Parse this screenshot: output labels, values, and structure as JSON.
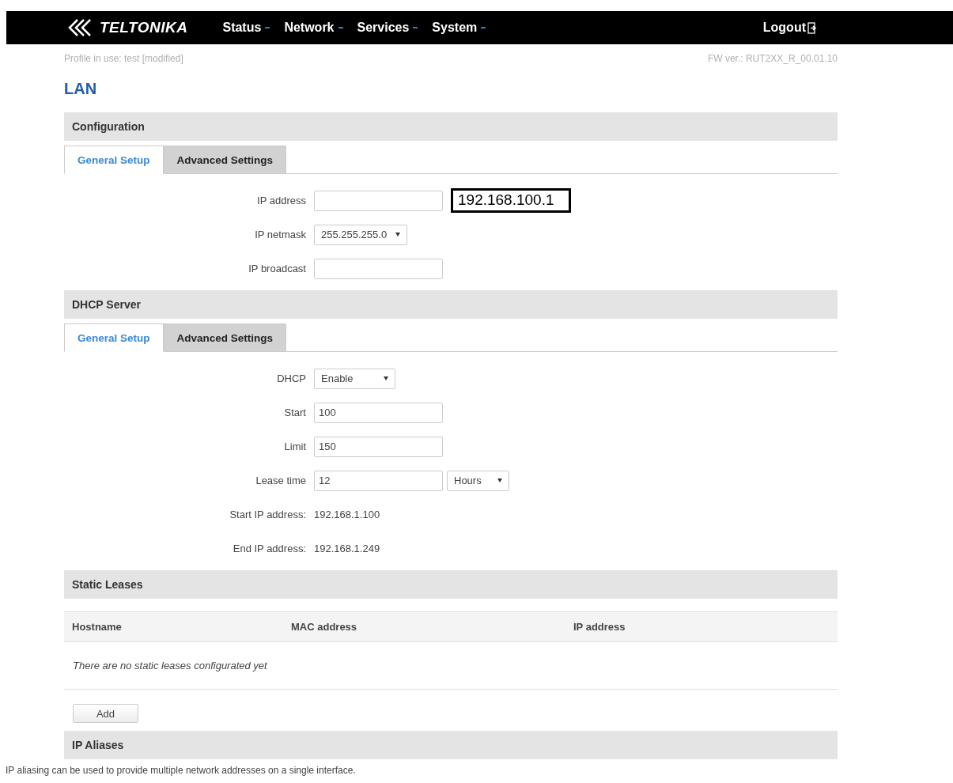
{
  "header": {
    "brand": "TELTONIKA",
    "menu": [
      {
        "label": "Status",
        "has_dropdown": true
      },
      {
        "label": "Network",
        "has_dropdown": true
      },
      {
        "label": "Services",
        "has_dropdown": true
      },
      {
        "label": "System",
        "has_dropdown": true
      }
    ],
    "logout": "Logout"
  },
  "profile": "Profile in use: test [modified]",
  "firmware": "FW ver.: RUT2XX_R_00.01.10",
  "page_title": "LAN",
  "sections": [
    {
      "title": "Configuration",
      "tabs": [
        {
          "label": "General Setup",
          "selected": true
        },
        {
          "label": "Advanced Settings",
          "selected": false
        }
      ],
      "rows": [
        {
          "label": "IP address",
          "kind": "input",
          "value": "",
          "annotation": "192.168.100.1"
        },
        {
          "label": "IP netmask",
          "kind": "select",
          "value": "255.255.255.0"
        },
        {
          "label": "IP broadcast",
          "kind": "input",
          "value": ""
        }
      ]
    },
    {
      "title": "DHCP Server",
      "tabs": [
        {
          "label": "General Setup",
          "selected": true
        },
        {
          "label": "Advanced Settings",
          "selected": false
        }
      ],
      "rows": [
        {
          "label": "DHCP",
          "kind": "select",
          "value": "Enable"
        },
        {
          "label": "Start",
          "kind": "input",
          "value": "100"
        },
        {
          "label": "Limit",
          "kind": "input",
          "value": "150"
        },
        {
          "label": "Lease time",
          "kind": "input",
          "value": "12",
          "unit": "Hours"
        },
        {
          "label": "Start IP address:",
          "kind": "info",
          "value": "192.168.1.100"
        },
        {
          "label": "End IP address:",
          "kind": "info",
          "value": "192.168.1.249"
        }
      ]
    }
  ],
  "static_leases": {
    "title": "Static Leases",
    "columns": [
      "Hostname",
      "MAC address",
      "IP address"
    ],
    "empty": "There are no static leases configurated yet",
    "add_button": "Add"
  },
  "ip_aliases": {
    "title": "IP Aliases",
    "description": "IP aliasing can be used to provide multiple network addresses on a single interface."
  }
}
